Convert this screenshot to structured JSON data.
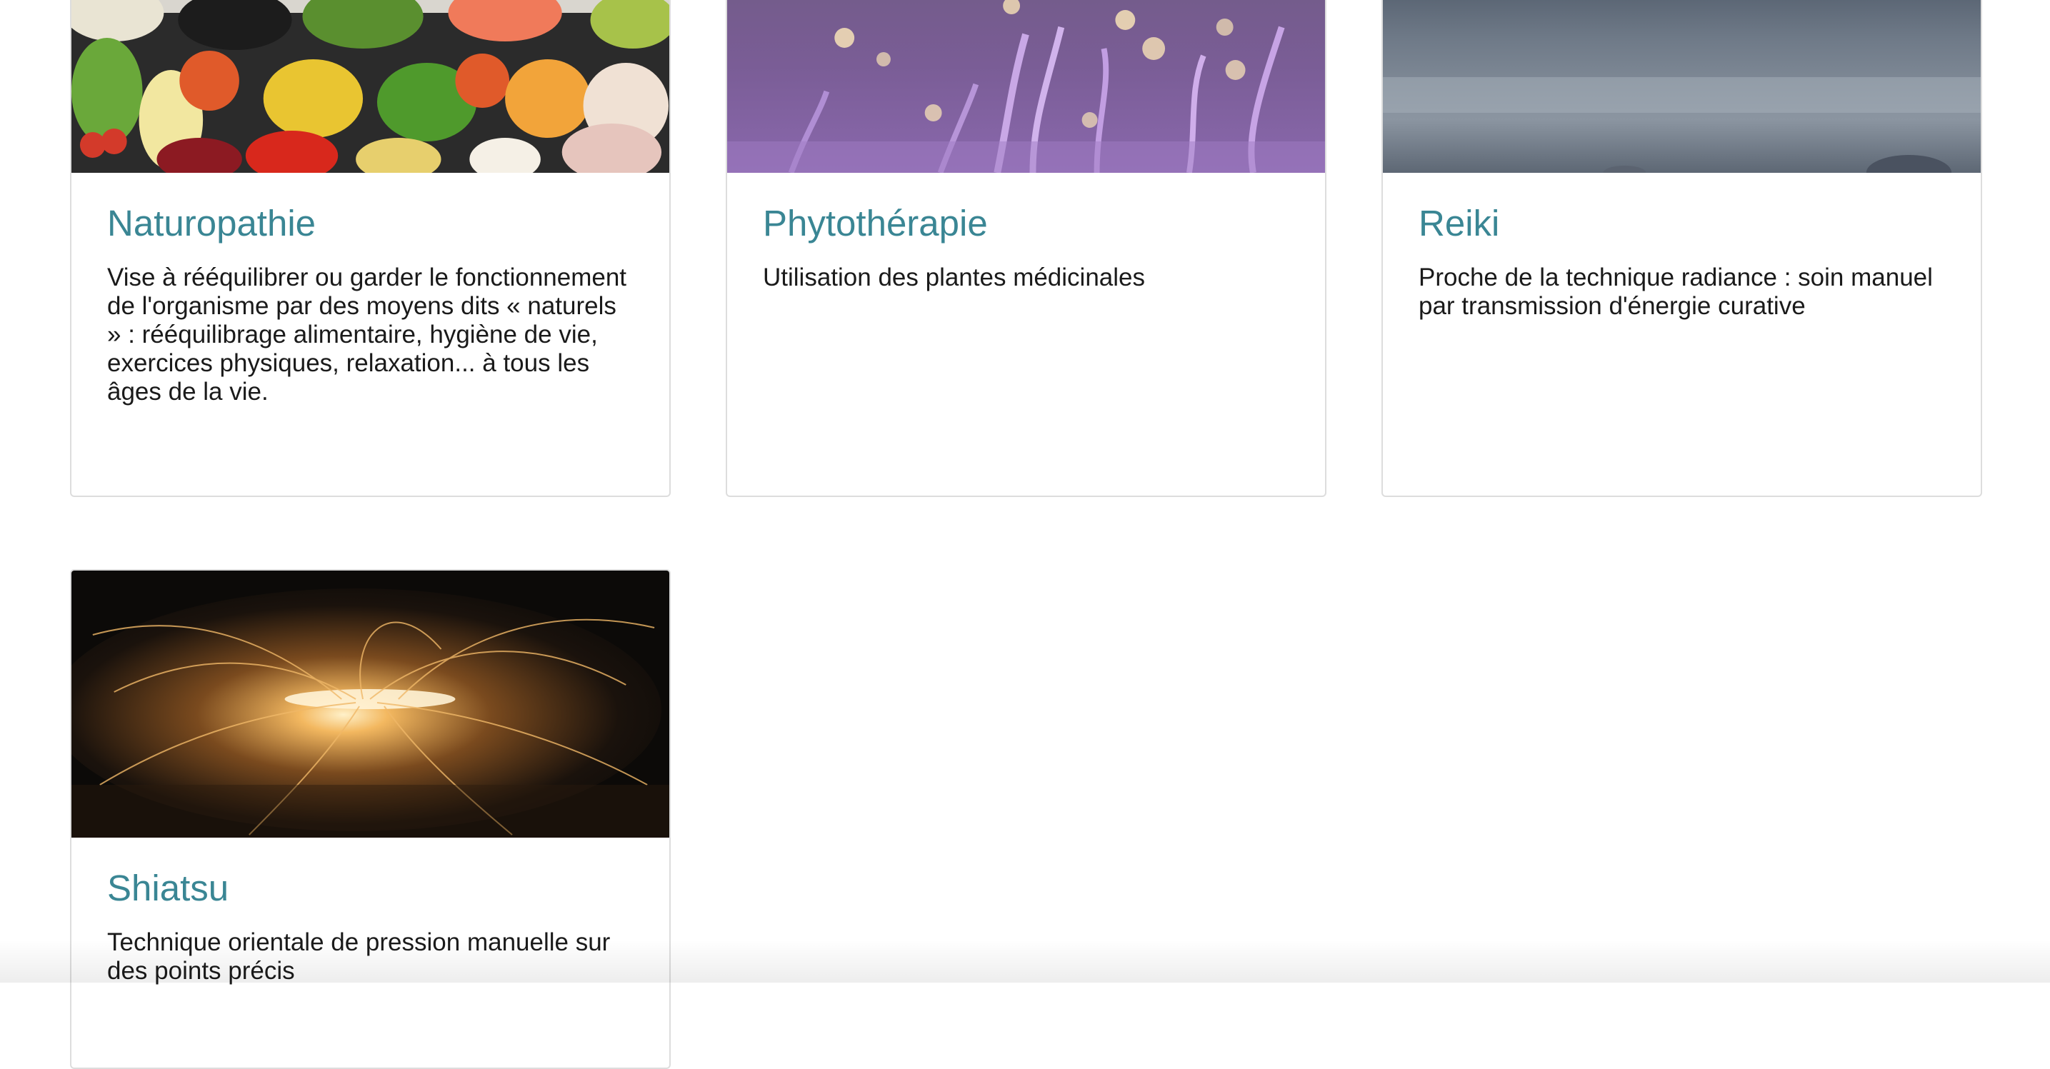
{
  "cards": [
    {
      "title": "Naturopathie",
      "text": "Vise à rééquilibrer ou garder le fonctionnement de l'organisme par des moyens dits « naturels » : rééquilibrage alimentaire, hygiène de vie, exercices physiques, relaxation... à tous les âges de la vie.",
      "image": "vegetable-platter-photo"
    },
    {
      "title": "Phytothérapie",
      "text": "Utilisation des plantes médicinales",
      "image": "lavender-field-photo"
    },
    {
      "title": "Reiki",
      "text": "Proche de la technique radiance : soin manuel par transmission d'énergie curative",
      "image": "hands-blurred-photo"
    },
    {
      "title": "Shiatsu",
      "text": "Technique orientale de pression manuelle sur des points précis",
      "image": "steel-wool-sparks-photo"
    }
  ],
  "colors": {
    "title": "#3a8694",
    "text": "#1a1a1a",
    "card_border": "#dddddd"
  }
}
